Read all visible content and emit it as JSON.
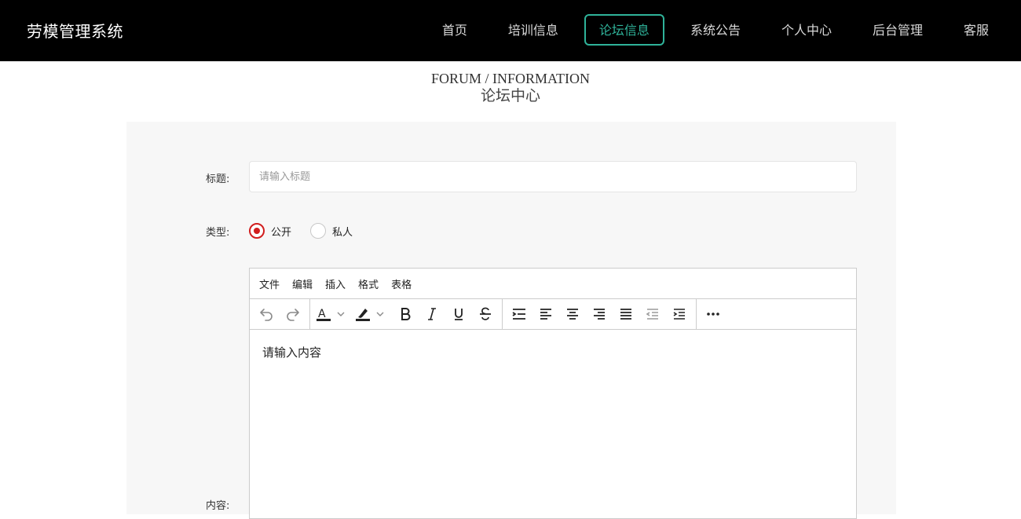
{
  "header": {
    "brand": "劳模管理系统",
    "nav": [
      {
        "label": "首页",
        "active": false
      },
      {
        "label": "培训信息",
        "active": false
      },
      {
        "label": "论坛信息",
        "active": true
      },
      {
        "label": "系统公告",
        "active": false
      },
      {
        "label": "个人中心",
        "active": false
      },
      {
        "label": "后台管理",
        "active": false
      },
      {
        "label": "客服",
        "active": false
      }
    ]
  },
  "page": {
    "title_en": "FORUM / INFORMATION",
    "title_cn": "论坛中心"
  },
  "form": {
    "title_label": "标题:",
    "title_placeholder": "请输入标题",
    "title_value": "",
    "type_label": "类型:",
    "type_options": [
      {
        "label": "公开",
        "checked": true
      },
      {
        "label": "私人",
        "checked": false
      }
    ],
    "content_label": "内容:",
    "accent_color": "#d11e1e"
  },
  "editor": {
    "menu": [
      "文件",
      "编辑",
      "插入",
      "格式",
      "表格"
    ],
    "toolbar_icons": [
      "undo-icon",
      "redo-icon",
      "text-color-icon",
      "highlight-icon",
      "bold-icon",
      "italic-icon",
      "underline-icon",
      "strikethrough-icon",
      "line-height-icon",
      "align-left-icon",
      "align-center-icon",
      "align-right-icon",
      "align-justify-icon",
      "outdent-icon",
      "indent-icon",
      "more-icon"
    ],
    "content": "请输入内容"
  },
  "theme": {
    "nav_active_color": "#2fb39a",
    "topbar_color": "#000000"
  }
}
